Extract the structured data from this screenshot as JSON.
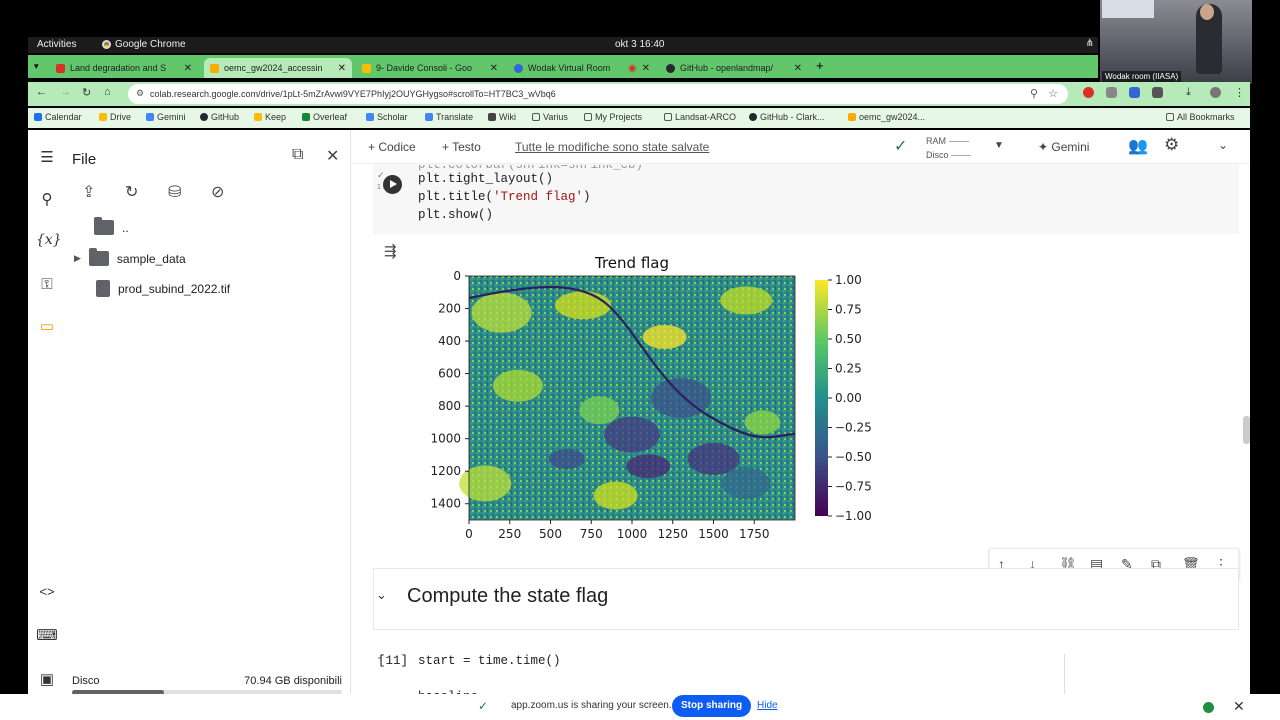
{
  "gnome": {
    "activities": "Activities",
    "app": "Google Chrome",
    "clock": "okt 3  16:40"
  },
  "video": {
    "label": "Wodak room (IIASA)"
  },
  "tabs": [
    {
      "title": "Land degradation and S",
      "color": "#d93025"
    },
    {
      "title": "oemc_gw2024_accessin",
      "color": "#f9ab00"
    },
    {
      "title": "9- Davide Consoli - Goo",
      "color": "#fbbc04"
    },
    {
      "title": "Wodak Virtual Room",
      "color": "#3367d6"
    },
    {
      "title": "GitHub - openlandmap/",
      "color": "#24292f"
    }
  ],
  "addressbar": {
    "url": "colab.research.google.com/drive/1pLt-5mZrAvwi9VYE7PhIyj2OUYGHygso#scrollTo=HT7BC3_wVbq6"
  },
  "bookmarks": [
    {
      "label": "Calendar",
      "color": "#1a73e8"
    },
    {
      "label": "Drive",
      "color": "#fbbc04"
    },
    {
      "label": "Gemini",
      "color": "#4285f4"
    },
    {
      "label": "GitHub",
      "color": "#24292f"
    },
    {
      "label": "Keep",
      "color": "#fbbc04"
    },
    {
      "label": "Overleaf",
      "color": "#138a36"
    },
    {
      "label": "Scholar",
      "color": "#4285f4"
    },
    {
      "label": "Translate",
      "color": "#4285f4"
    },
    {
      "label": "Wiki",
      "color": "#444"
    },
    {
      "label": "Varius",
      "color": "#555"
    },
    {
      "label": "My Projects",
      "color": "#555"
    },
    {
      "label": "Landsat-ARCO",
      "color": "#555"
    },
    {
      "label": "GitHub - Clark...",
      "color": "#24292f"
    },
    {
      "label": "oemc_gw2024...",
      "color": "#f9ab00"
    }
  ],
  "all_bookmarks": "All Bookmarks",
  "filepanel": {
    "title": "File",
    "items": [
      "..",
      "sample_data",
      "prod_subind_2022.tif"
    ],
    "disk_label": "Disco",
    "disk_free": "70.94 GB disponibili",
    "disk_used_fraction": 0.34
  },
  "toolbar": {
    "code": "+ Codice",
    "text": "+ Testo",
    "unsaved": "Tutte le modifiche sono state salvate",
    "ram": "RAM",
    "disk": "Disco",
    "gemini": "Gemini"
  },
  "cell1": {
    "exec_time": "1 s",
    "lines": [
      "plt.tight_layout()",
      "plt.title('Trend flag')",
      "plt.show()"
    ]
  },
  "cell2": {
    "heading": "Compute the state flag"
  },
  "cell3": {
    "prompt": "[11]",
    "line1": "start = time.time()",
    "line2": "baseline ="
  },
  "zoom": {
    "message": "app.zoom.us is sharing your screen.",
    "stop": "Stop sharing",
    "hide": "Hide"
  },
  "chart_data": {
    "type": "heatmap",
    "title": "Trend flag",
    "xticks": [
      "0",
      "250",
      "500",
      "750",
      "1000",
      "1250",
      "1500",
      "1750"
    ],
    "yticks": [
      "0",
      "200",
      "400",
      "600",
      "800",
      "1000",
      "1200",
      "1400"
    ],
    "xlim": [
      0,
      2000
    ],
    "ylim": [
      1500,
      0
    ],
    "colorbar": {
      "min": -1.0,
      "max": 1.0,
      "ticks": [
        "1.00",
        "0.75",
        "0.50",
        "0.25",
        "0.00",
        "−0.25",
        "−0.50",
        "−0.75",
        "−1.00"
      ],
      "colormap": "viridis"
    }
  }
}
